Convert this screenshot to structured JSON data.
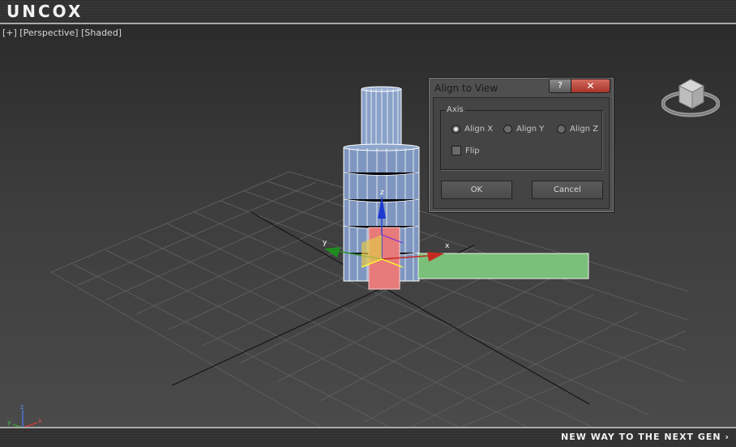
{
  "branding": {
    "logo": "UNCOX",
    "tagline": "NEW WAY TO THE NEXT GEN ›"
  },
  "viewport": {
    "label": "[+] [Perspective] [Shaded]",
    "gizmo_axes": {
      "x": "x",
      "y": "y",
      "z": "z"
    }
  },
  "dialog": {
    "title": "Align to View",
    "help_label": "?",
    "close_label": "✕",
    "group_label": "Axis",
    "radios": [
      {
        "label": "Align X",
        "selected": true
      },
      {
        "label": "Align Y",
        "selected": false
      },
      {
        "label": "Align Z",
        "selected": false
      }
    ],
    "flip_label": "Flip",
    "flip_checked": false,
    "ok_label": "OK",
    "cancel_label": "Cancel"
  },
  "colors": {
    "accent_close": "#b8463a",
    "object_blue": "#7f97c0",
    "green_plane": "#7abf7a",
    "red_plane": "#e77a7a"
  },
  "icons": [
    "view-cube-icon",
    "axis-tripod-icon",
    "transform-gizmo-icon"
  ]
}
